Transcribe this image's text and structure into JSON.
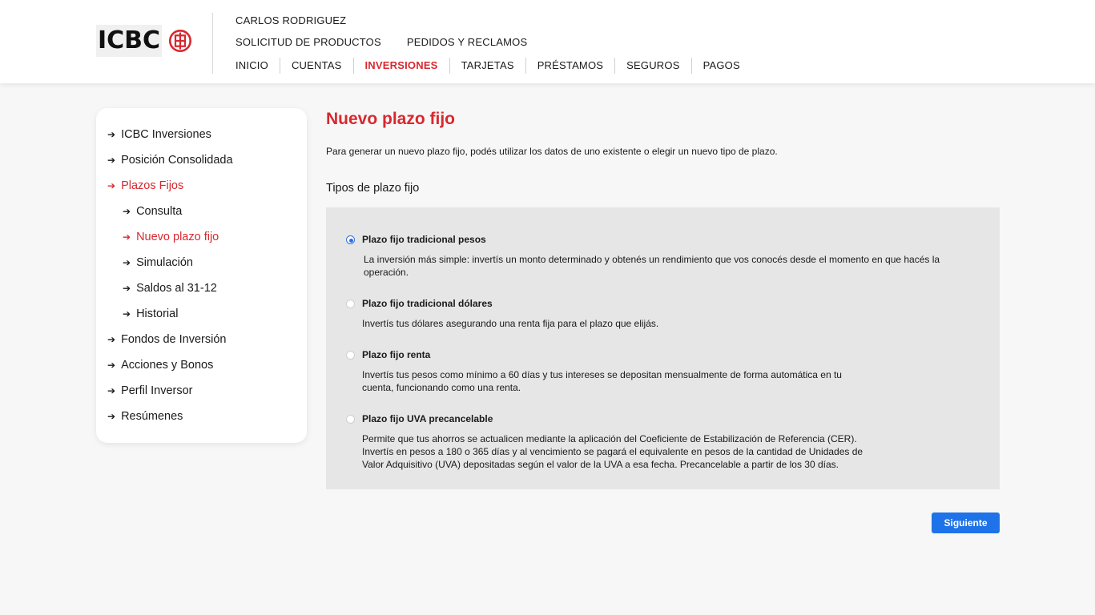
{
  "header": {
    "logo_text": "ICBC",
    "user_name": "CARLOS RODRIGUEZ",
    "top_links": [
      "SOLICITUD DE PRODUCTOS",
      "PEDIDOS Y RECLAMOS"
    ],
    "nav": [
      "INICIO",
      "CUENTAS",
      "INVERSIONES",
      "TARJETAS",
      "PRÉSTAMOS",
      "SEGUROS",
      "PAGOS"
    ],
    "active_nav": "INVERSIONES",
    "brand_color": "#d8282f"
  },
  "sidebar": {
    "items": [
      {
        "label": "ICBC Inversiones",
        "level": 0,
        "active": false
      },
      {
        "label": "Posición Consolidada",
        "level": 0,
        "active": false
      },
      {
        "label": "Plazos Fijos",
        "level": 0,
        "active": true
      },
      {
        "label": "Consulta",
        "level": 1,
        "active": false
      },
      {
        "label": "Nuevo plazo fijo",
        "level": 1,
        "active": true
      },
      {
        "label": "Simulación",
        "level": 1,
        "active": false
      },
      {
        "label": "Saldos al 31-12",
        "level": 1,
        "active": false
      },
      {
        "label": "Historial",
        "level": 1,
        "active": false
      },
      {
        "label": "Fondos de Inversión",
        "level": 0,
        "active": false
      },
      {
        "label": "Acciones y Bonos",
        "level": 0,
        "active": false
      },
      {
        "label": "Perfil Inversor",
        "level": 0,
        "active": false
      },
      {
        "label": "Resúmenes",
        "level": 0,
        "active": false
      }
    ],
    "arrow_icon": "arrow-right-icon"
  },
  "main": {
    "title": "Nuevo plazo fijo",
    "intro": "Para generar un nuevo plazo fijo, podés utilizar los datos de uno existente o elegir un nuevo tipo de plazo.",
    "section_title": "Tipos de plazo fijo",
    "options": [
      {
        "title": "Plazo fijo tradicional pesos",
        "selected": true,
        "desc": [
          "La inversión más simple: invertís un monto determinado y  obtenés un rendimiento que vos conocés desde el momento en que hacés la",
          "operación."
        ]
      },
      {
        "title": "Plazo fijo tradicional dólares",
        "selected": false,
        "desc": [
          "Invertís tus dólares asegurando una renta fija para el plazo que elijás."
        ]
      },
      {
        "title": "Plazo fijo renta",
        "selected": false,
        "desc": [
          "Invertís tus pesos como mínimo a 60 días y tus intereses se depositan  mensualmente de forma automática en tu",
          "cuenta, funcionando como una  renta."
        ]
      },
      {
        "title": "Plazo fijo UVA precancelable",
        "selected": false,
        "desc": [
          "Permite que tus ahorros se actualicen mediante la aplicación  del Coeficiente de Estabilización de Referencia (CER).",
          "Invertís en pesos a 180 o 365 días y al vencimiento se pagará el equivalente en pesos de  la cantidad de Unidades de",
          "Valor Adquisitivo (UVA) depositadas según el  valor de la UVA a esa fecha. Precancelable a partir de los 30 días."
        ]
      }
    ],
    "next_label": "Siguiente",
    "button_color": "#1f73e8"
  }
}
